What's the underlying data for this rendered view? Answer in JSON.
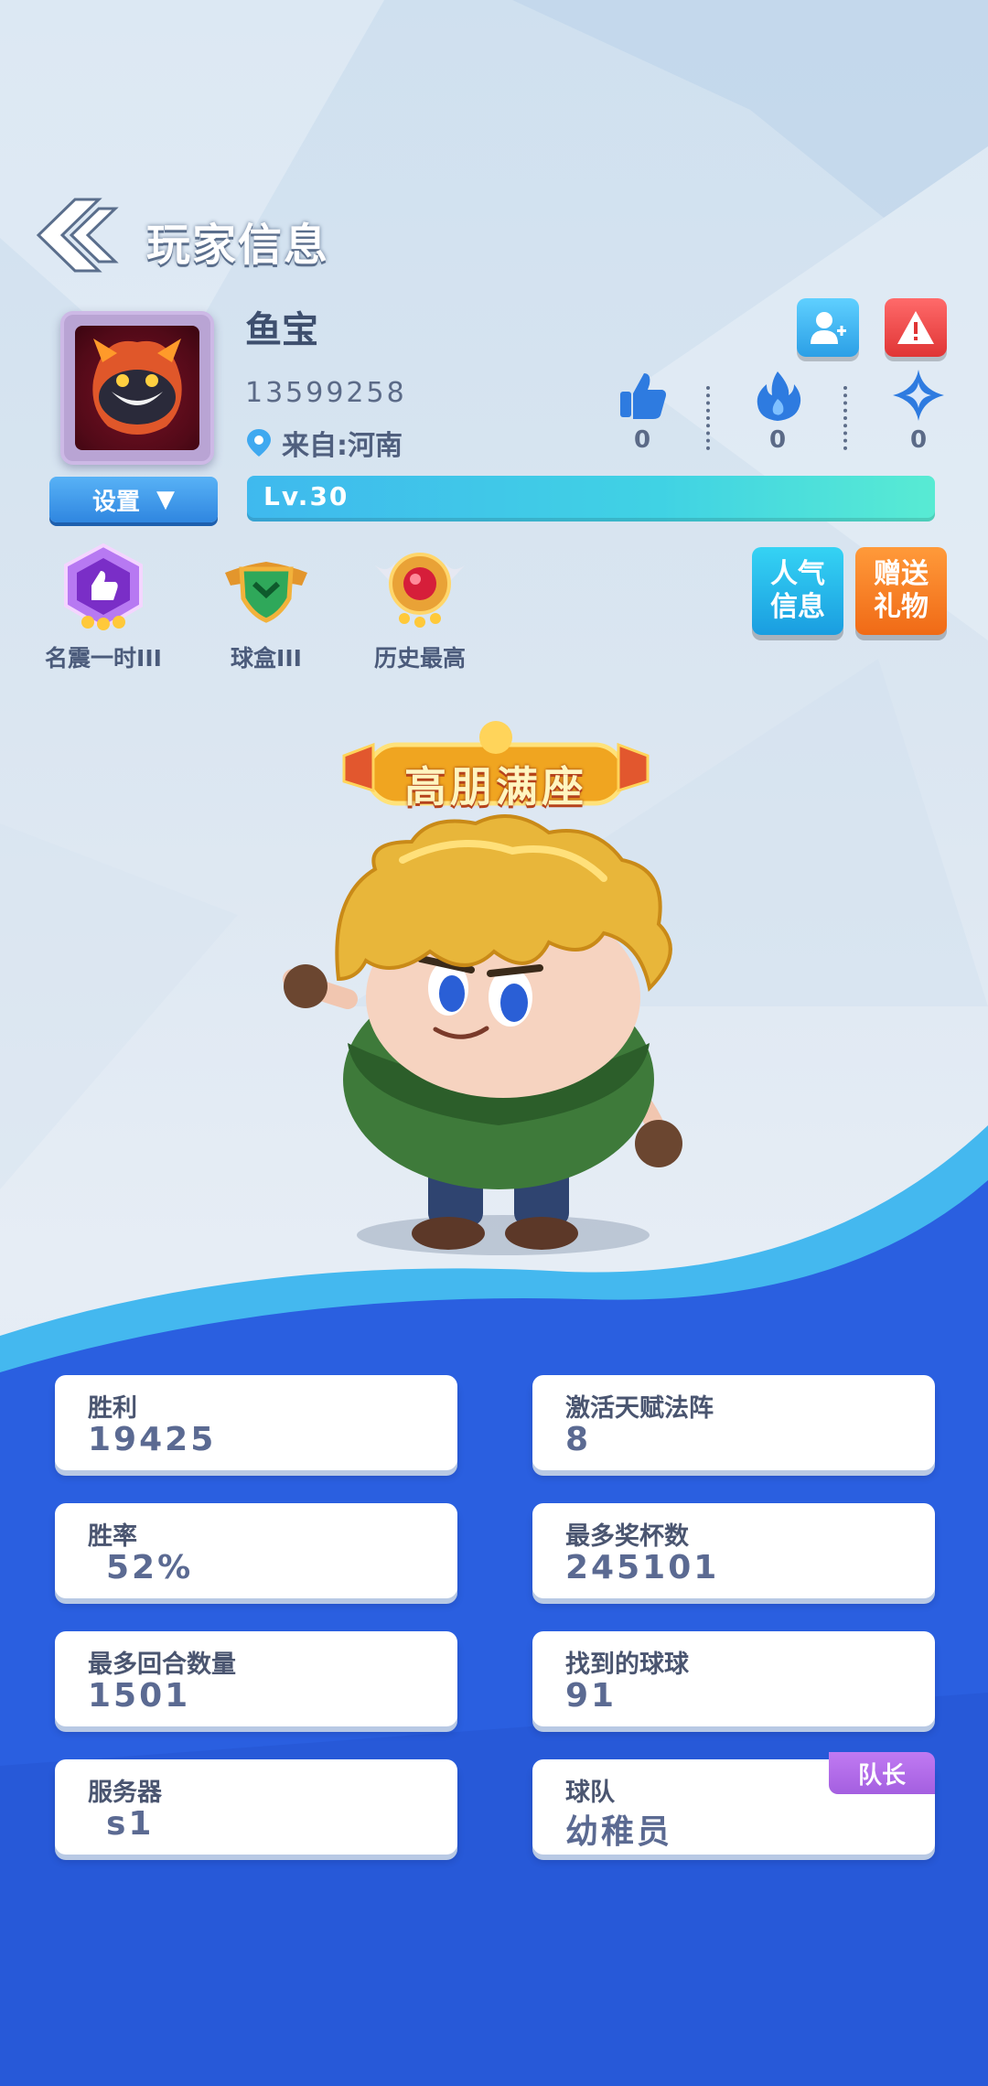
{
  "header": {
    "title": "玩家信息"
  },
  "player": {
    "name": "鱼宝",
    "id": "13599258",
    "location": "来自:河南",
    "level": "Lv.30"
  },
  "buttons": {
    "settings": "设置",
    "popularity_line1": "人气",
    "popularity_line2": "信息",
    "gift_line1": "赠送",
    "gift_line2": "礼物"
  },
  "social_stats": [
    {
      "icon": "thumbs-up-icon",
      "value": "0"
    },
    {
      "icon": "fire-icon",
      "value": "0"
    },
    {
      "icon": "sparkle-icon",
      "value": "0"
    }
  ],
  "badges": [
    {
      "icon": "thumbs-up-medal-icon",
      "label": "名震一时III"
    },
    {
      "icon": "green-shield-badge-icon",
      "label": "球盒III"
    },
    {
      "icon": "ruby-trophy-badge-icon",
      "label": "历史最高"
    }
  ],
  "banner": {
    "text": "高朋满座"
  },
  "stats": [
    {
      "label": "胜利",
      "value": "19425"
    },
    {
      "label": "激活天赋法阵",
      "value": "8"
    },
    {
      "label": "胜率",
      "value": "52%"
    },
    {
      "label": "最多奖杯数",
      "value": "245101"
    },
    {
      "label": "最多回合数量",
      "value": "1501"
    },
    {
      "label": "找到的球球",
      "value": "91"
    },
    {
      "label": "服务器",
      "value": "s1"
    },
    {
      "label": "球队",
      "value": "幼稚员",
      "tag": "队长"
    }
  ],
  "colors": {
    "accent_blue": "#2f86e0",
    "level_bar": "#40d2e4",
    "gift_orange": "#f06a16",
    "report_red": "#e03535",
    "captain_purple": "#a45fe0",
    "bottom_blue": "#2a5fe0"
  }
}
